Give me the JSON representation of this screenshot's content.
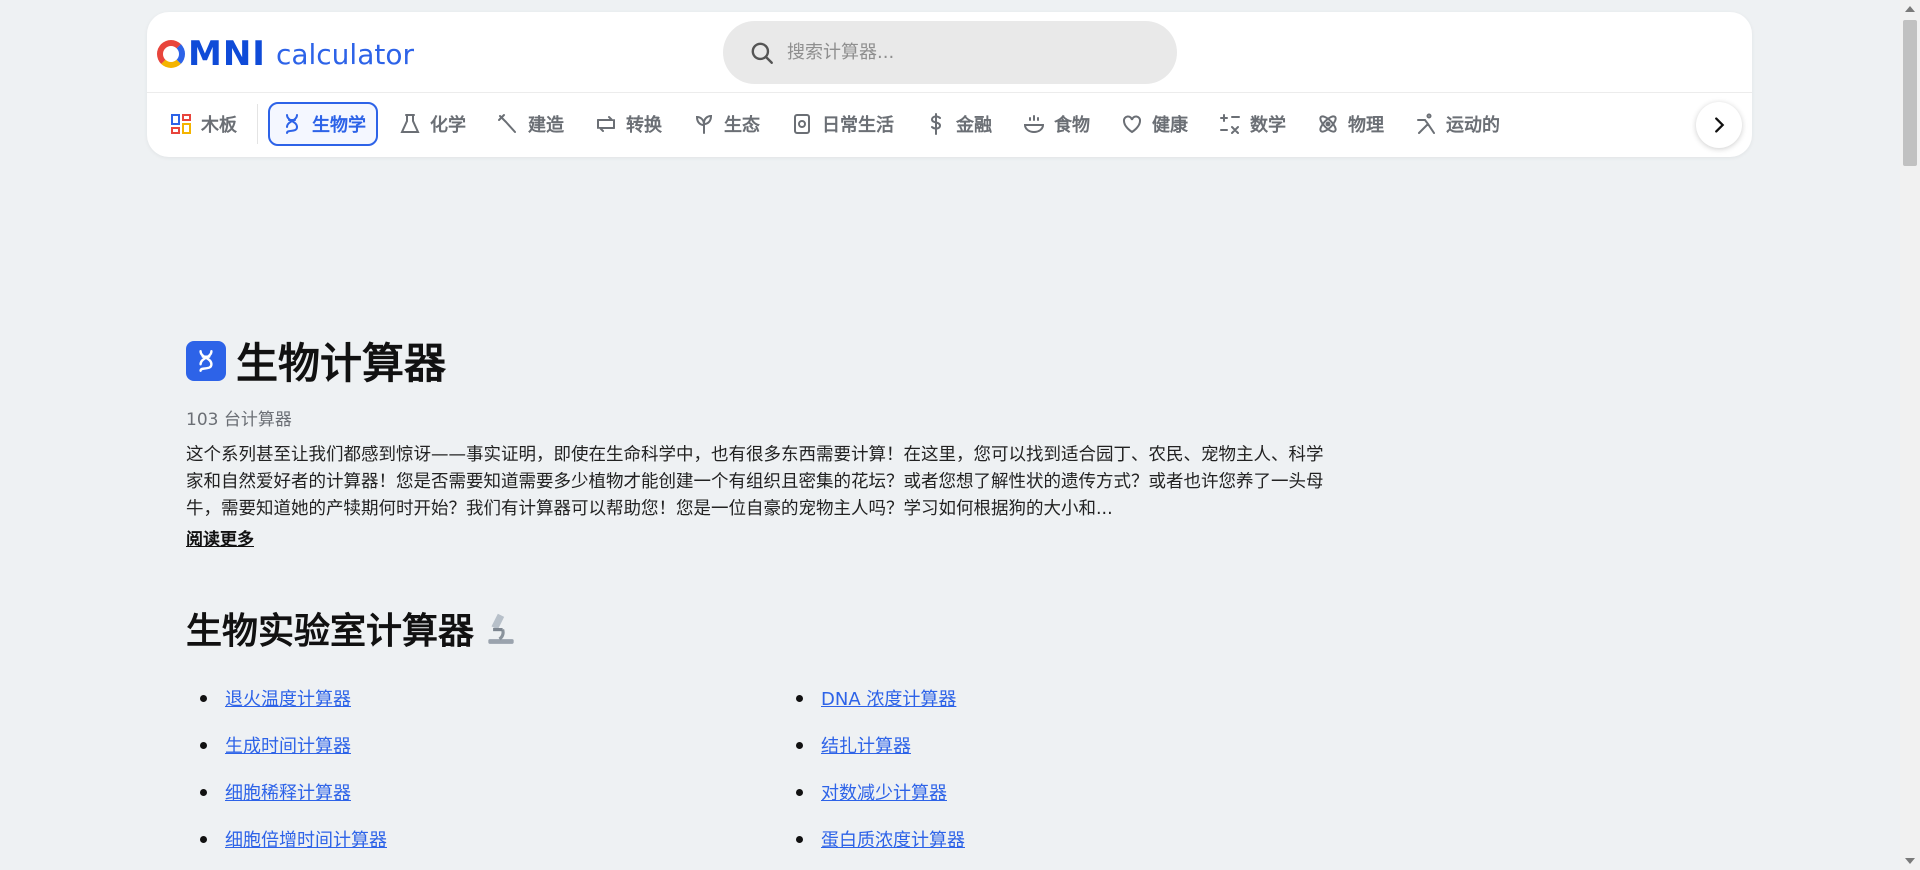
{
  "header": {
    "logo_omni": "omni",
    "logo_calculator": "calculator",
    "search_placeholder": "搜索计算器...",
    "nav": [
      {
        "label": "木板",
        "icon": "board-icon",
        "active": false
      },
      {
        "label": "生物学",
        "icon": "dna-icon",
        "active": true
      },
      {
        "label": "化学",
        "icon": "flask-icon",
        "active": false
      },
      {
        "label": "建造",
        "icon": "construction-icon",
        "active": false
      },
      {
        "label": "转换",
        "icon": "conversion-icon",
        "active": false
      },
      {
        "label": "生态",
        "icon": "leaf-icon",
        "active": false
      },
      {
        "label": "日常生活",
        "icon": "everyday-icon",
        "active": false
      },
      {
        "label": "金融",
        "icon": "dollar-icon",
        "active": false
      },
      {
        "label": "食物",
        "icon": "food-icon",
        "active": false
      },
      {
        "label": "健康",
        "icon": "heart-icon",
        "active": false
      },
      {
        "label": "数学",
        "icon": "math-icon",
        "active": false
      },
      {
        "label": "物理",
        "icon": "atom-icon",
        "active": false
      },
      {
        "label": "运动的",
        "icon": "sport-icon",
        "active": false
      }
    ]
  },
  "main": {
    "title": "生物计算器",
    "count": "103 台计算器",
    "intro": "这个系列甚至让我们都感到惊讶——事实证明，即使在生命科学中，也有很多东西需要计算！在这里，您可以找到适合园丁、农民、宠物主人、科学家和自然爱好者的计算器！您是否需要知道需要多少植物才能创建一个有组织且密集的花坛？或者您想了解性状的遗传方式？或者也许您养了一头母牛，需要知道她的产犊期何时开始？我们有计算器可以帮助您！您是一位自豪的宠物主人吗？学习如何根据狗的大小和...",
    "read_more": "阅读更多",
    "section_title": "生物实验室计算器",
    "links_left": [
      "退火温度计算器",
      "生成时间计算器",
      "细胞稀释计算器",
      "细胞倍增时间计算器"
    ],
    "links_right": [
      "DNA 浓度计算器",
      "结扎计算器",
      "对数减少计算器",
      "蛋白质浓度计算器"
    ]
  },
  "colors": {
    "accent": "#2d63e8",
    "background": "#eef1f3"
  }
}
